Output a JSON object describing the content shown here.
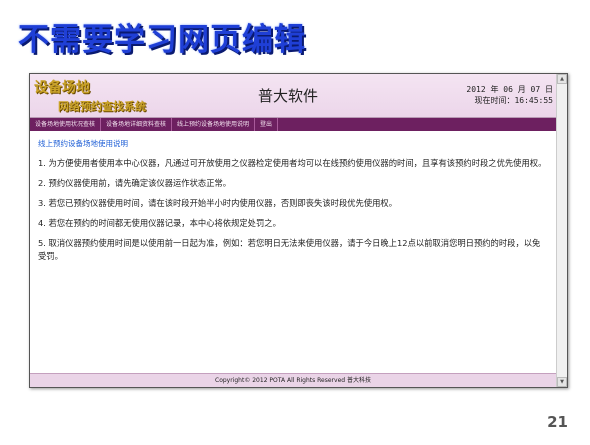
{
  "slide": {
    "title": "不需要学习网页编辑",
    "page_number": "21"
  },
  "window": {
    "logo_line1": "设备场地",
    "logo_line2": "网络预约查找系统",
    "system_name": "普大软件",
    "date_line": "2012 年 06 月 07 日",
    "time_line": "现在时间：16:45:55",
    "nav": [
      {
        "label": "设备场地使用状况查核"
      },
      {
        "label": "设备场地详细资料查核"
      },
      {
        "label": "线上预约设备场地使用说明"
      },
      {
        "label": "登出"
      }
    ],
    "section_title": "线上预约设备场地使用说明",
    "rules": [
      "1. 为方便使用者使用本中心仪器，凡通过可开放使用之仪器检定使用者均可以在线预约使用仪器的时间，且享有该预约时段之优先使用权。",
      "2. 预约仪器使用前，请先确定该仪器运作状态正常。",
      "3. 若您已预约仪器使用时间，请在该时段开始半小时内使用仪器，否则即丧失该时段优先使用权。",
      "4. 若您在预约的时间都无使用仪器记录，本中心将依规定处罚之。",
      "5. 取消仪器预约使用时间是以使用前一日起为准，例如：若您明日无法来使用仪器，请于今日晚上12点以前取消您明日预约的时段，以免受罚。"
    ],
    "footer": "Copyright© 2012 POTA All Rights Reserved 普大科技"
  }
}
